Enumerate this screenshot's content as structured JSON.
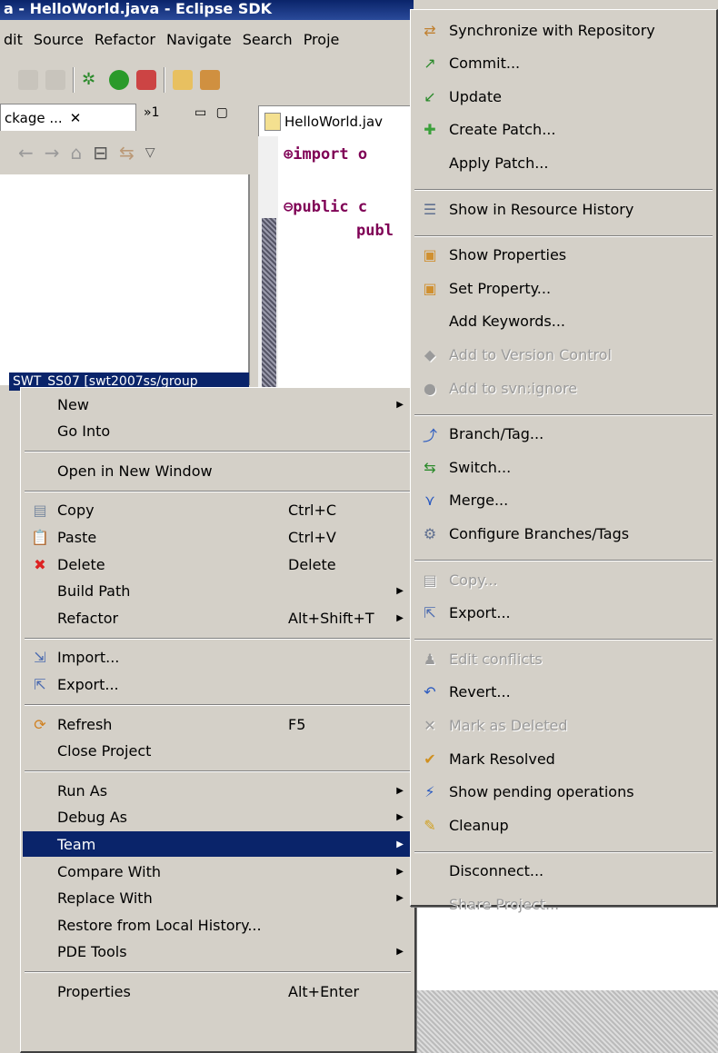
{
  "window": {
    "title": "a - HelloWorld.java - Eclipse SDK"
  },
  "menubar": [
    "dit",
    "Source",
    "Refactor",
    "Navigate",
    "Search",
    "Proje"
  ],
  "package_explorer": {
    "tab_label": "ckage ...",
    "close": "✕",
    "overflow": "»1",
    "selected_item": "SWT_SS07 [swt2007ss/group"
  },
  "editor": {
    "tab_label": "HelloWorld.jav",
    "lines": [
      "⊕import o",
      "⊖public c",
      "publ"
    ]
  },
  "context_menu": {
    "items": [
      {
        "label": "New",
        "shortcut": "",
        "submenu": true,
        "icon": ""
      },
      {
        "label": "Go Into",
        "shortcut": "",
        "submenu": false,
        "icon": ""
      },
      {
        "sep": true
      },
      {
        "label": "Open in New Window",
        "shortcut": "",
        "submenu": false,
        "icon": ""
      },
      {
        "sep": true
      },
      {
        "label": "Copy",
        "shortcut": "Ctrl+C",
        "submenu": false,
        "icon": "copy-icon"
      },
      {
        "label": "Paste",
        "shortcut": "Ctrl+V",
        "submenu": false,
        "icon": "paste-icon"
      },
      {
        "label": "Delete",
        "shortcut": "Delete",
        "submenu": false,
        "icon": "delete-icon"
      },
      {
        "label": "Build Path",
        "shortcut": "",
        "submenu": true,
        "icon": ""
      },
      {
        "label": "Refactor",
        "shortcut": "Alt+Shift+T",
        "submenu": true,
        "icon": ""
      },
      {
        "sep": true
      },
      {
        "label": "Import...",
        "shortcut": "",
        "submenu": false,
        "icon": "import-icon"
      },
      {
        "label": "Export...",
        "shortcut": "",
        "submenu": false,
        "icon": "export-icon"
      },
      {
        "sep": true
      },
      {
        "label": "Refresh",
        "shortcut": "F5",
        "submenu": false,
        "icon": "refresh-icon"
      },
      {
        "label": "Close Project",
        "shortcut": "",
        "submenu": false,
        "icon": ""
      },
      {
        "sep": true
      },
      {
        "label": "Run As",
        "shortcut": "",
        "submenu": true,
        "icon": ""
      },
      {
        "label": "Debug As",
        "shortcut": "",
        "submenu": true,
        "icon": ""
      },
      {
        "label": "Team",
        "shortcut": "",
        "submenu": true,
        "icon": "",
        "highlighted": true
      },
      {
        "label": "Compare With",
        "shortcut": "",
        "submenu": true,
        "icon": ""
      },
      {
        "label": "Replace With",
        "shortcut": "",
        "submenu": true,
        "icon": ""
      },
      {
        "label": "Restore from Local History...",
        "shortcut": "",
        "submenu": false,
        "icon": ""
      },
      {
        "label": "PDE Tools",
        "shortcut": "",
        "submenu": true,
        "icon": ""
      },
      {
        "sep": true
      },
      {
        "label": "Properties",
        "shortcut": "Alt+Enter",
        "submenu": false,
        "icon": ""
      }
    ]
  },
  "team_menu": {
    "items": [
      {
        "label": "Synchronize with Repository",
        "icon": "synchronize-icon",
        "disabled": false
      },
      {
        "label": "Commit...",
        "icon": "commit-icon",
        "disabled": false
      },
      {
        "label": "Update",
        "icon": "update-icon",
        "disabled": false
      },
      {
        "label": "Create Patch...",
        "icon": "create-patch-icon",
        "disabled": false
      },
      {
        "label": "Apply Patch...",
        "icon": "",
        "disabled": false
      },
      {
        "sep": true
      },
      {
        "label": "Show in Resource History",
        "icon": "resource-history-icon",
        "disabled": false
      },
      {
        "sep": true
      },
      {
        "label": "Show Properties",
        "icon": "show-properties-icon",
        "disabled": false
      },
      {
        "label": "Set Property...",
        "icon": "set-property-icon",
        "disabled": false
      },
      {
        "label": "Add Keywords...",
        "icon": "",
        "disabled": false
      },
      {
        "label": "Add to Version Control",
        "icon": "add-version-control-icon",
        "disabled": true
      },
      {
        "label": "Add to svn:ignore",
        "icon": "svn-ignore-icon",
        "disabled": true
      },
      {
        "sep": true
      },
      {
        "label": "Branch/Tag...",
        "icon": "branch-tag-icon",
        "disabled": false
      },
      {
        "label": "Switch...",
        "icon": "switch-icon",
        "disabled": false
      },
      {
        "label": "Merge...",
        "icon": "merge-icon",
        "disabled": false
      },
      {
        "label": "Configure Branches/Tags",
        "icon": "configure-branches-icon",
        "disabled": false
      },
      {
        "sep": true
      },
      {
        "label": "Copy...",
        "icon": "copy-icon",
        "disabled": true
      },
      {
        "label": "Export...",
        "icon": "export-icon",
        "disabled": false
      },
      {
        "sep": true
      },
      {
        "label": "Edit conflicts",
        "icon": "edit-conflicts-icon",
        "disabled": true
      },
      {
        "label": "Revert...",
        "icon": "revert-icon",
        "disabled": false
      },
      {
        "label": "Mark as Deleted",
        "icon": "mark-deleted-icon",
        "disabled": true
      },
      {
        "label": "Mark Resolved",
        "icon": "mark-resolved-icon",
        "disabled": false
      },
      {
        "label": "Show pending operations",
        "icon": "pending-operations-icon",
        "disabled": false
      },
      {
        "label": "Cleanup",
        "icon": "cleanup-icon",
        "disabled": false
      },
      {
        "sep": true
      },
      {
        "label": "Disconnect...",
        "icon": "",
        "disabled": false
      },
      {
        "label": "Share Project...",
        "icon": "",
        "disabled": true
      }
    ]
  },
  "icon_glyphs": {
    "copy-icon": "▤",
    "paste-icon": "📋",
    "delete-icon": "✖",
    "import-icon": "⇲",
    "export-icon": "⇱",
    "refresh-icon": "⟳",
    "synchronize-icon": "⇄",
    "commit-icon": "↗",
    "update-icon": "↙",
    "create-patch-icon": "✚",
    "resource-history-icon": "☰",
    "show-properties-icon": "▣",
    "set-property-icon": "▣",
    "add-version-control-icon": "◆",
    "svn-ignore-icon": "●",
    "branch-tag-icon": "⤴",
    "switch-icon": "⇆",
    "merge-icon": "⋎",
    "configure-branches-icon": "⚙",
    "edit-conflicts-icon": "♟",
    "revert-icon": "↶",
    "mark-deleted-icon": "✕",
    "mark-resolved-icon": "✔",
    "pending-operations-icon": "⚡",
    "cleanup-icon": "✎"
  },
  "colors": {
    "menu_bg": "#d4d0c8",
    "highlight": "#0a246a",
    "disabled": "#9a9a9a",
    "delete": "#d22",
    "green": "#2a8a2a",
    "blue": "#2a5ac0",
    "orange": "#e8a020"
  }
}
